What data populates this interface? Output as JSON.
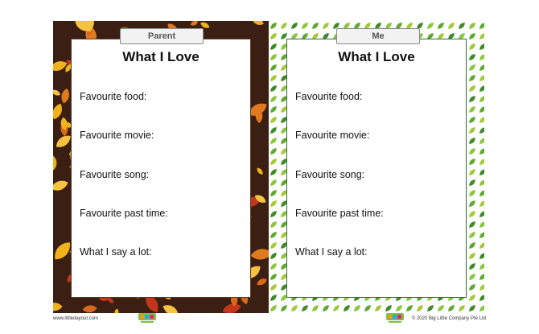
{
  "left_card": {
    "tag": "Parent",
    "title": "What I Love",
    "fields": [
      "Favourite food:",
      "Favourite movie:",
      "Favourite song:",
      "Favourite past time:",
      "What I say a lot:"
    ]
  },
  "right_card": {
    "tag": "Me",
    "title": "What I Love",
    "fields": [
      "Favourite food:",
      "Favourite movie:",
      "Favourite song:",
      "Favourite past time:",
      "What I say a lot:"
    ]
  },
  "footer": {
    "url": "www.littledayout.com",
    "copyright": "© 2020 Big Little Company Pte Ltd"
  },
  "colors": {
    "autumn_bg": "#3a1f12",
    "leaf_orange": "#e07a1f",
    "leaf_yellow": "#f2b21b",
    "leaf_red": "#c2361b",
    "leaf_green": "#5fa832",
    "leaf_lime": "#a6c93a"
  }
}
